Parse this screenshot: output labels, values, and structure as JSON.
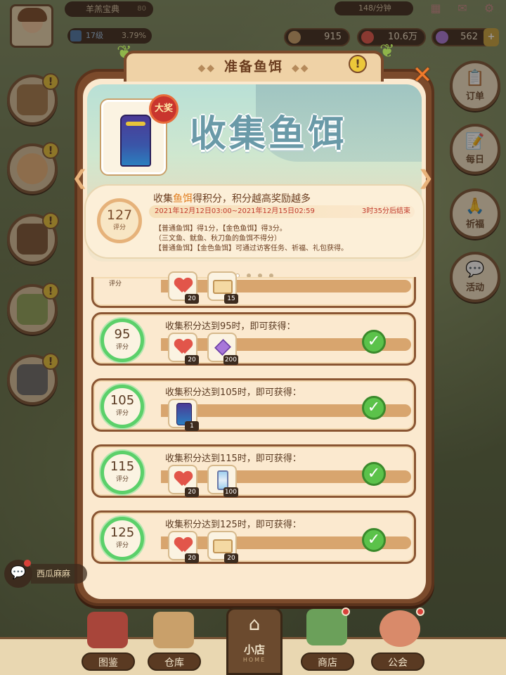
{
  "top": {
    "title": "羊羔宝典",
    "title_num": "80",
    "level": "17级",
    "level_pct": "3.79%",
    "rate": "148/分钟",
    "currency1": "915",
    "currency2": "10.6万",
    "currency3": "562"
  },
  "side_right": [
    {
      "label": "订单",
      "icon": "📋"
    },
    {
      "label": "每日",
      "icon": "📝"
    },
    {
      "label": "祈福",
      "icon": "🙏"
    },
    {
      "label": "活动",
      "icon": "💬"
    }
  ],
  "panel": {
    "title": "准备鱼饵",
    "banner_title": "收集鱼饵",
    "prize_badge": "大奖",
    "score": "127",
    "score_unit": "评分",
    "headline_pre": "收集",
    "headline_hl": "鱼饵",
    "headline_post": "得积分，积分越高奖励越多",
    "time_range": "2021年12月12日03:00~2021年12月15日02:59",
    "time_left": "3时35分后结束",
    "rule1": "【普通鱼饵】得1分，【金色鱼饵】得3分。",
    "rule2": "（三文鱼、鱿鱼、秋刀鱼的鱼饵不得分）",
    "rule3": "【普通鱼饵】【金色鱼饵】可通过访客任务、祈福、礼包获得。"
  },
  "rows": [
    {
      "score": "95",
      "unit": "评分",
      "text": "收集积分达到95时，即可获得：",
      "items": [
        {
          "type": "heart",
          "count": "20"
        },
        {
          "type": "gem",
          "count": "200"
        }
      ]
    },
    {
      "score": "105",
      "unit": "评分",
      "text": "收集积分达到105时，即可获得：",
      "items": [
        {
          "type": "robe",
          "count": "1"
        }
      ]
    },
    {
      "score": "115",
      "unit": "评分",
      "text": "收集积分达到115时，即可获得：",
      "items": [
        {
          "type": "heart",
          "count": "20"
        },
        {
          "type": "hourglass",
          "count": "100"
        }
      ]
    },
    {
      "score": "125",
      "unit": "评分",
      "text": "收集积分达到125时，即可获得：",
      "items": [
        {
          "type": "heart",
          "count": "20"
        },
        {
          "type": "ticket",
          "count": "20"
        }
      ]
    }
  ],
  "partial_row": {
    "unit": "评分",
    "counts": [
      "20",
      "15"
    ]
  },
  "bottom": {
    "chat": "西瓜麻麻",
    "nav": [
      "图鉴",
      "仓库",
      "商店",
      "公会"
    ],
    "home": "小店",
    "home_sub": "HOME"
  },
  "colors": {
    "accent": "#7b4a2b",
    "check": "#5bc24a",
    "ring": "#5bd06a"
  }
}
